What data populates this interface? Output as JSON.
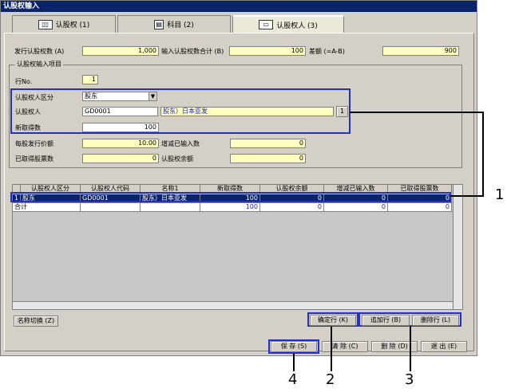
{
  "window": {
    "title": "认股权输入"
  },
  "tabs": [
    {
      "label": "认股权 (1)",
      "icon": "book-icon"
    },
    {
      "label": "科目 (2)",
      "icon": "document-icon"
    },
    {
      "label": "认股权人 (3)",
      "icon": "form-icon"
    }
  ],
  "top_fields": {
    "issue_label": "发行认股权数 (A)",
    "issue_value": "1,000",
    "input_total_label": "输入认股权数合计 (B)",
    "input_total_value": "100",
    "diff_label": "差额 (=A-B)",
    "diff_value": "900"
  },
  "group": {
    "title": "认股权输入项目",
    "row_no_label": "行No.",
    "row_no_value": "1",
    "holder_type_label": "认股权人区分",
    "holder_type_value": "股东",
    "holder_label": "认股权人",
    "holder_code": "GD0001",
    "holder_name": "股东）日本亚发",
    "lookup_button": "1",
    "new_shares_label": "新取得数",
    "new_shares_value": "100",
    "unit_price_label": "每股发行价额",
    "unit_price_value": "10.00",
    "increase_label": "增减已输入数",
    "increase_value": "0",
    "acquired_label": "已取得股票数",
    "acquired_value": "0",
    "balance_label": "认股权余额",
    "balance_value": "0"
  },
  "grid": {
    "headers": [
      "",
      "认股权人区分",
      "认股权人代码",
      "名称1",
      "新取得数",
      "认股权余额",
      "增减已输入数",
      "已取得股票数"
    ],
    "rows": [
      {
        "no": "1",
        "type": "股东",
        "code": "GD0001",
        "name": "股东）日本亚发",
        "new": "100",
        "balance": "0",
        "increase": "0",
        "acquired": "0"
      }
    ],
    "total": {
      "label": "合计",
      "new": "100",
      "balance": "0",
      "increase": "0",
      "acquired": "0"
    }
  },
  "buttons": {
    "name_switch": "名称切换 (Z)",
    "confirm_row": "确定行 (K)",
    "add_row": "追加行 (B)",
    "delete_row": "删除行 (L)",
    "save": "保  存 (S)",
    "clear": "清  除 (C)",
    "delete": "删  除 (D)",
    "exit": "退  出 (E)"
  },
  "callouts": [
    "1",
    "2",
    "3",
    "4"
  ]
}
